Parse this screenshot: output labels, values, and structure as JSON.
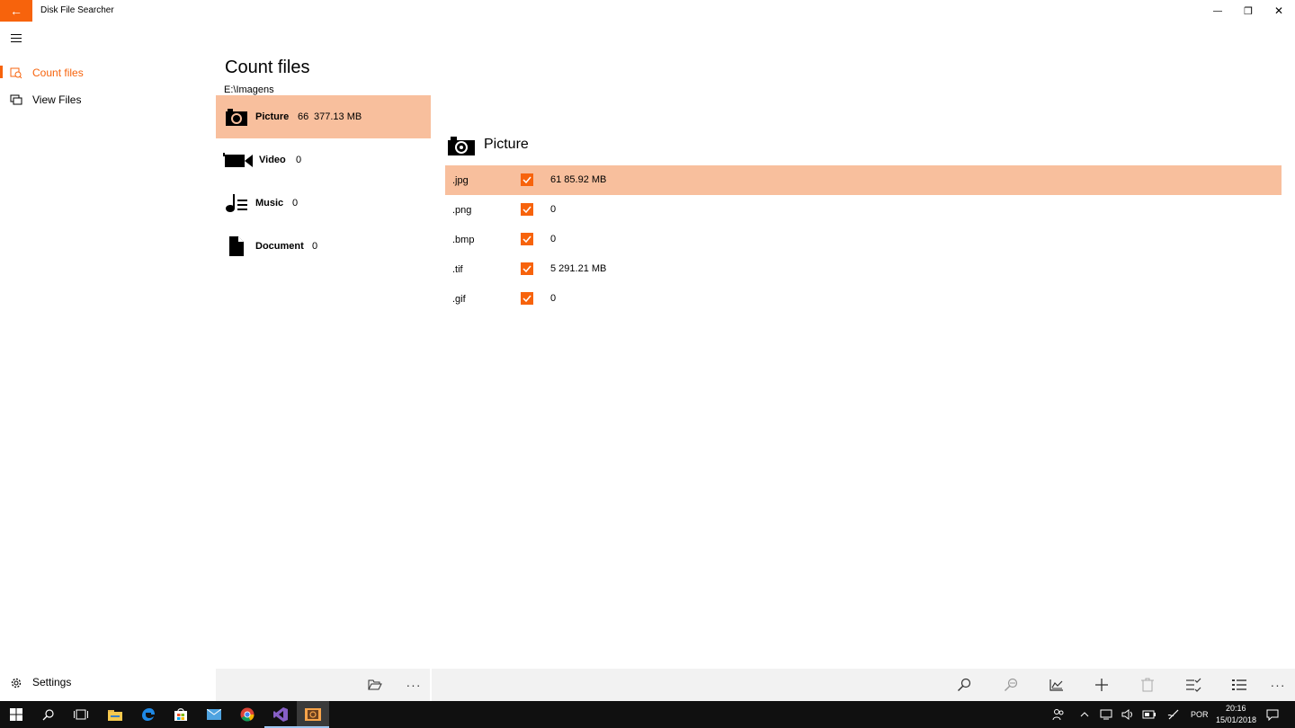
{
  "app": {
    "title": "Disk File Searcher",
    "back_glyph": "←"
  },
  "window_controls": {
    "minimize": "—",
    "maximize": "❐",
    "close": "✕"
  },
  "nav": {
    "items": [
      {
        "label": "Count files",
        "icon": "count-files-icon",
        "selected": true
      },
      {
        "label": "View Files",
        "icon": "view-files-icon",
        "selected": false
      }
    ],
    "settings_label": "Settings"
  },
  "page": {
    "title": "Count files",
    "path": "E:\\Imagens"
  },
  "categories": [
    {
      "name": "Picture",
      "count": "66",
      "size": "377.13 MB",
      "icon": "camera-icon",
      "selected": true
    },
    {
      "name": "Video",
      "count": "0",
      "size": "",
      "icon": "video-camera-icon",
      "selected": false
    },
    {
      "name": "Music",
      "count": "0",
      "size": "",
      "icon": "music-icon",
      "selected": false
    },
    {
      "name": "Document",
      "count": "0",
      "size": "",
      "icon": "document-icon",
      "selected": false
    }
  ],
  "detail": {
    "title": "Picture",
    "icon": "camera-icon",
    "extensions": [
      {
        "ext": ".jpg",
        "checked": true,
        "value": "61  85.92 MB",
        "selected": true
      },
      {
        "ext": ".png",
        "checked": true,
        "value": "0",
        "selected": false
      },
      {
        "ext": ".bmp",
        "checked": true,
        "value": "0",
        "selected": false
      },
      {
        "ext": ".tif",
        "checked": true,
        "value": "5  291.21 MB",
        "selected": false
      },
      {
        "ext": ".gif",
        "checked": true,
        "value": "0",
        "selected": false
      }
    ]
  },
  "command_bar": {
    "left": [
      "open-folder-icon",
      "more-icon"
    ],
    "right": [
      "search-icon",
      "search-disabled-icon",
      "chart-icon",
      "add-icon",
      "delete-icon",
      "checklist-icon",
      "list-icon",
      "more-icon"
    ],
    "more_glyph": "···"
  },
  "taskbar": {
    "language": "POR",
    "time": "20:16",
    "date": "15/01/2018"
  },
  "colors": {
    "accent": "#f7630c",
    "selection": "#f8bf9d",
    "command_bar_bg": "#f2f2f2",
    "taskbar_bg": "#101010"
  }
}
